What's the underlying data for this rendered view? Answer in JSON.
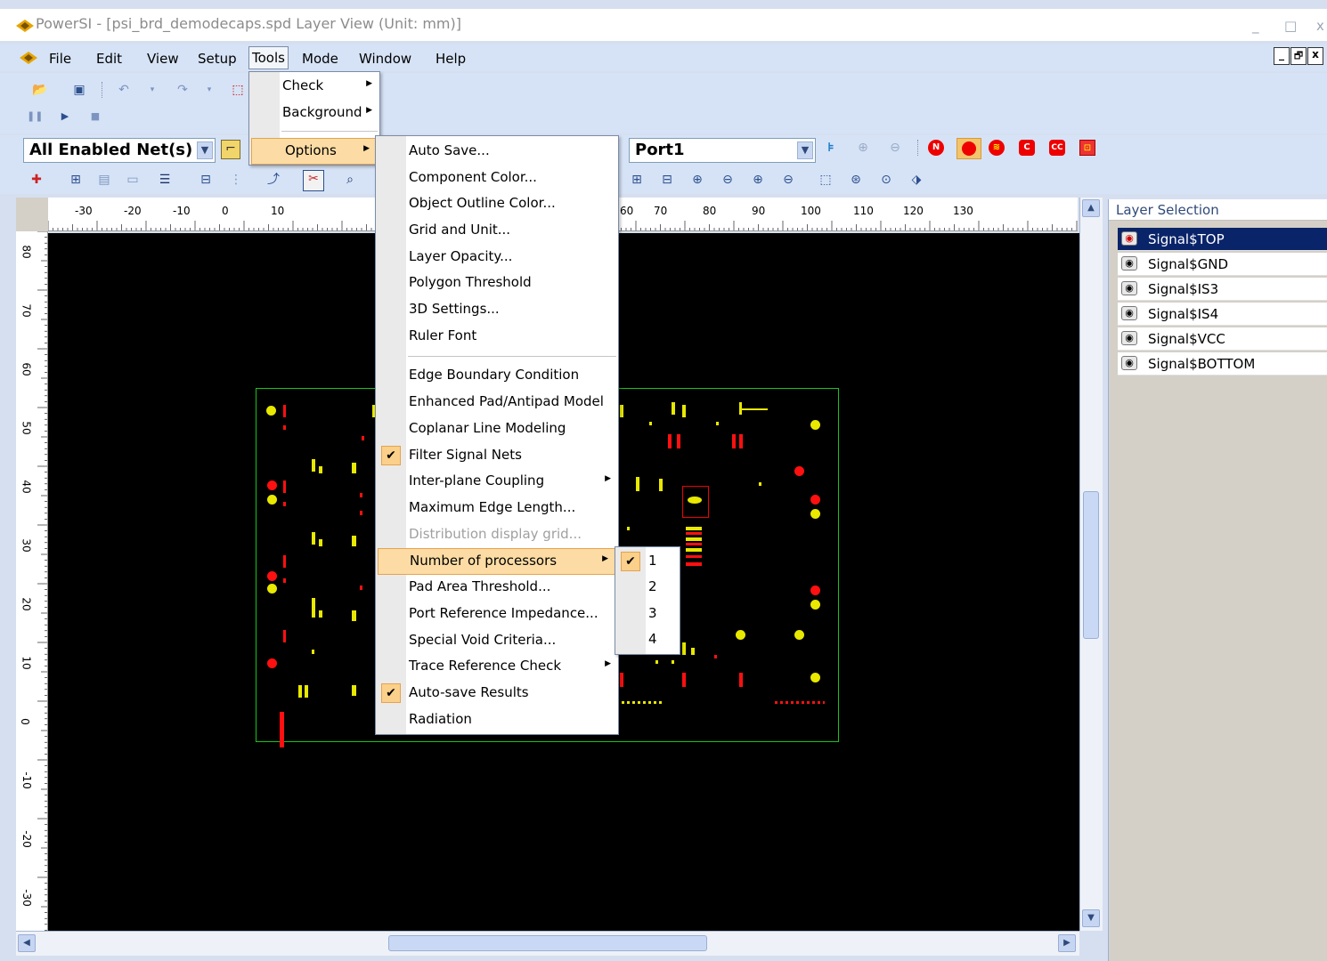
{
  "window": {
    "title": "PowerSI - [psi_brd_demodecaps.spd Layer View (Unit: mm)]",
    "controls": [
      "_",
      "□",
      "x"
    ]
  },
  "menubar": {
    "items": [
      "File",
      "Edit",
      "View",
      "Setup",
      "Tools",
      "Mode",
      "Window",
      "Help"
    ],
    "active": "Tools",
    "mdi_controls": [
      "_",
      "🗗",
      "x"
    ]
  },
  "toolbar": {
    "net_filter": "All Enabled Net(s)",
    "port_select": "Port1"
  },
  "tools_menu": {
    "items": [
      {
        "label": "Check",
        "submenu": true
      },
      {
        "label": "Background",
        "submenu": true
      },
      {
        "label": "Options",
        "submenu": true,
        "highlighted": true
      }
    ]
  },
  "options_menu": {
    "items": [
      {
        "label": "Auto Save..."
      },
      {
        "label": "Component Color..."
      },
      {
        "label": "Object Outline Color..."
      },
      {
        "label": "Grid and Unit..."
      },
      {
        "label": "Layer Opacity..."
      },
      {
        "label": "Polygon Threshold"
      },
      {
        "label": "3D Settings..."
      },
      {
        "label": "Ruler Font"
      },
      {
        "label": "Edge Boundary Condition"
      },
      {
        "label": "Enhanced Pad/Antipad Model"
      },
      {
        "label": "Coplanar Line Modeling"
      },
      {
        "label": "Filter Signal Nets",
        "checked": true
      },
      {
        "label": "Inter-plane Coupling",
        "submenu": true
      },
      {
        "label": "Maximum Edge Length..."
      },
      {
        "label": "Distribution display grid...",
        "disabled": true
      },
      {
        "label": "Number of processors",
        "submenu": true,
        "highlighted": true
      },
      {
        "label": "Pad Area Threshold..."
      },
      {
        "label": "Port Reference Impedance..."
      },
      {
        "label": "Special Void Criteria..."
      },
      {
        "label": "Trace Reference Check",
        "submenu": true
      },
      {
        "label": "Auto-save Results",
        "checked": true
      },
      {
        "label": "Radiation"
      }
    ]
  },
  "processors_menu": {
    "items": [
      {
        "label": "1",
        "checked": true
      },
      {
        "label": "2"
      },
      {
        "label": "3"
      },
      {
        "label": "4"
      }
    ]
  },
  "rulers": {
    "horizontal": [
      "-30",
      "-20",
      "-10",
      "0",
      "10",
      "60",
      "70",
      "80",
      "90",
      "100",
      "110",
      "120",
      "130"
    ],
    "vertical": [
      "80",
      "70",
      "60",
      "50",
      "40",
      "30",
      "20",
      "10",
      "0",
      "-10",
      "-20",
      "-30"
    ]
  },
  "layer_panel": {
    "title": "Layer Selection",
    "layers": [
      "Signal$TOP",
      "Signal$GND",
      "Signal$IS3",
      "Signal$IS4",
      "Signal$VCC",
      "Signal$BOTTOM"
    ],
    "selected": "Signal$TOP"
  },
  "colors": {
    "canvas": "#000000",
    "board_outline": "#19c319",
    "pad_yellow": "#e8e800",
    "pad_red": "#ff1010",
    "menu_highlight": "#fcdca4"
  }
}
